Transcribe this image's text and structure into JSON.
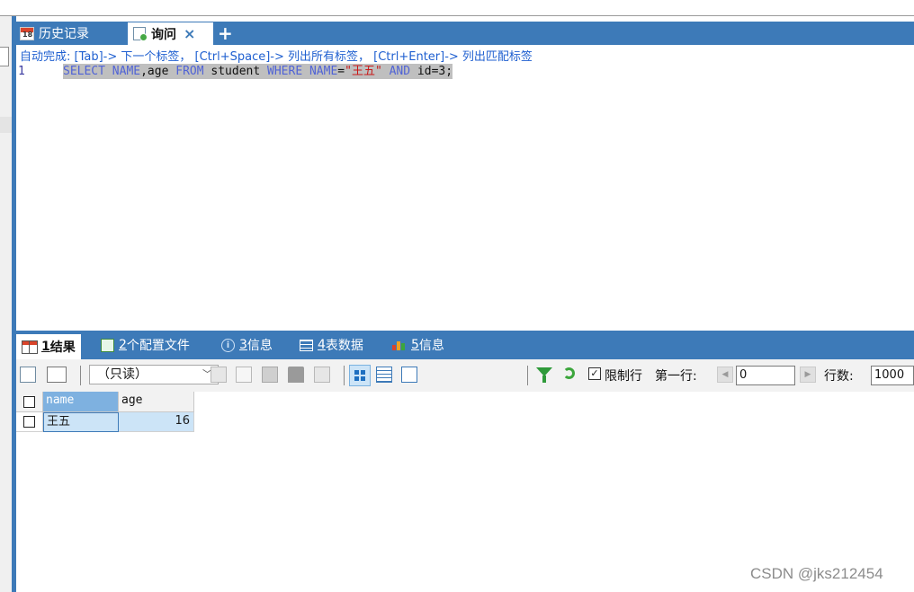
{
  "tabs": {
    "history_label": "历史记录",
    "history_day": "18",
    "query_label": "询问",
    "close_symbol": "×",
    "add_symbol": "+"
  },
  "editor": {
    "autocomplete_hint": "自动完成: [Tab]-> 下一个标签， [Ctrl+Space]-> 列出所有标签， [Ctrl+Enter]-> 列出匹配标签",
    "line_number": "1",
    "sql_tokens": {
      "kw_select": "SELECT",
      "col_name": " NAME",
      "comma_age": ",age ",
      "kw_from": "FROM",
      "table": " student ",
      "kw_where": "WHERE",
      "col_name2": " NAME",
      "eq": "=",
      "string_value": "\"王五\"",
      "sp": " ",
      "kw_and": "AND",
      "tail": " id=3;"
    }
  },
  "result_tabs": [
    {
      "num": "1",
      "label": " 结果"
    },
    {
      "num": "2",
      "label": " 个配置文件"
    },
    {
      "num": "3",
      "label": " 信息"
    },
    {
      "num": "4",
      "label": " 表数据"
    },
    {
      "num": "5",
      "label": " 信息"
    }
  ],
  "toolbar": {
    "readonly_value": "（只读）",
    "limit_label": "限制行",
    "limit_checked": "✓",
    "first_row_label": "第一行:",
    "first_row_value": "0",
    "row_count_label": "行数:",
    "row_count_value": "1000"
  },
  "grid": {
    "columns": [
      "name",
      "age"
    ],
    "rows": [
      {
        "name": "王五",
        "age": "16"
      }
    ]
  },
  "watermark": "CSDN @jks212454",
  "colors": {
    "accent_blue": "#3d7ab8",
    "keyword": "#5063d6",
    "string": "#c81818"
  }
}
